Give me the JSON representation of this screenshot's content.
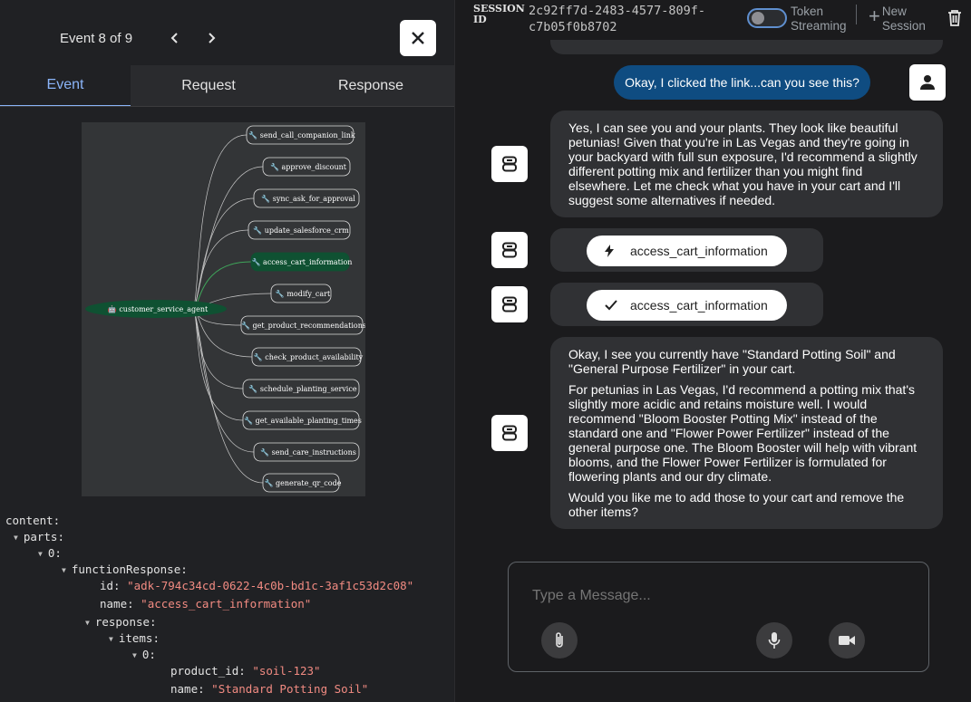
{
  "event_panel": {
    "counter": "Event 8 of 9",
    "tabs": [
      "Event",
      "Request",
      "Response"
    ]
  },
  "graph": {
    "root": "customer_service_agent",
    "tools": [
      "send_call_companion_link",
      "approve_discount",
      "sync_ask_for_approval",
      "update_salesforce_crm",
      "access_cart_information",
      "modify_cart",
      "get_product_recommendations",
      "check_product_availability",
      "schedule_planting_service",
      "get_available_planting_times",
      "send_care_instructions",
      "generate_qr_code"
    ],
    "highlighted": "access_cart_information"
  },
  "json_view": {
    "content": "content:",
    "parts": "parts:",
    "index0": "0:",
    "functionResponse": "functionResponse:",
    "id_key": "id:",
    "id_val": "\"adk-794c34cd-0622-4c0b-bd1c-3af1c53d2c08\"",
    "name_key": "name:",
    "name_val": "\"access_cart_information\"",
    "response": "response:",
    "items": "items:",
    "items_index0": "0:",
    "product_id_key": "product_id:",
    "product_id_val": "\"soil-123\"",
    "item_name_key": "name:",
    "item_name_val": "\"Standard Potting Soil\""
  },
  "topbar": {
    "session_label": "SESSION ID",
    "session_id": "2c92ff7d-2483-4577-809f-c7b05f0b8702",
    "token_streaming": "Token Streaming",
    "new_session": "New Session"
  },
  "chat": {
    "user_msg": "Okay, I clicked the link...can you see this?",
    "bot_msg1": "Yes, I can see you and your plants. They look like beautiful petunias! Given that you're in Las Vegas and they're going in your backyard with full sun exposure, I'd recommend a slightly different potting mix and fertilizer than you might find elsewhere. Let me check what you have in your cart and I'll suggest some alternatives if needed.",
    "fn_call": "access_cart_information",
    "fn_response": "access_cart_information",
    "bot_msg2_p1": "Okay, I see you currently have \"Standard Potting Soil\" and \"General Purpose Fertilizer\" in your cart.",
    "bot_msg2_p2": "For petunias in Las Vegas, I'd recommend a potting mix that's slightly more acidic and retains moisture well. I would recommend \"Bloom Booster Potting Mix\" instead of the standard one and \"Flower Power Fertilizer\" instead of the general purpose one. The Bloom Booster will help with vibrant blooms, and the Flower Power Fertilizer is formulated for flowering plants and our dry climate.",
    "bot_msg2_p3": "Would you like me to add those to your cart and remove the other items?"
  },
  "composer": {
    "placeholder": "Type a Message..."
  },
  "icons": {
    "prev": "chevron-left-icon",
    "next": "chevron-right-icon",
    "close": "close-icon",
    "trash": "trash-icon",
    "attach": "paperclip-icon",
    "mic": "mic-icon",
    "camera": "videocam-icon",
    "bolt": "bolt-icon",
    "check": "check-icon",
    "bot": "bot-icon",
    "user": "person-icon"
  },
  "colors": {
    "accent": "#8ab4f8",
    "user_bubble": "#0f4c81",
    "graph_highlight": "#0f5132",
    "json_string": "#f28b82"
  }
}
